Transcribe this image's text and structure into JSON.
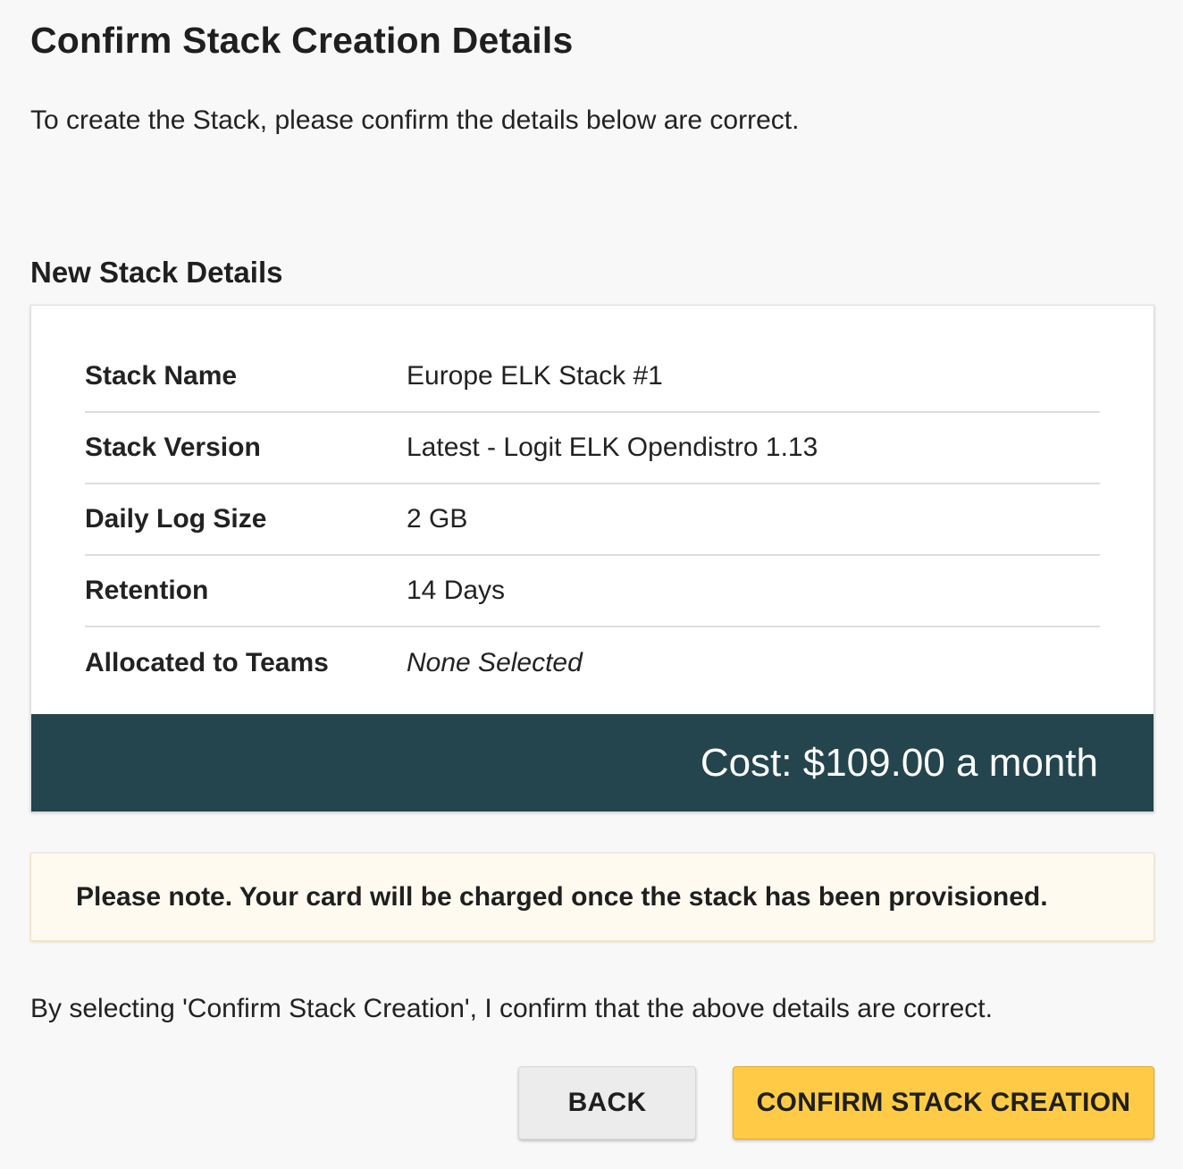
{
  "header": {
    "title": "Confirm Stack Creation Details",
    "intro": "To create the Stack, please confirm the details below are correct."
  },
  "details": {
    "section_title": "New Stack Details",
    "rows": [
      {
        "label": "Stack Name",
        "value": "Europe ELK Stack #1"
      },
      {
        "label": "Stack Version",
        "value": "Latest - Logit ELK Opendistro 1.13"
      },
      {
        "label": "Daily Log Size",
        "value": "2 GB"
      },
      {
        "label": "Retention",
        "value": "14 Days"
      },
      {
        "label": "Allocated to Teams",
        "value": "None Selected"
      }
    ],
    "cost": "Cost: $109.00 a month"
  },
  "notice": {
    "text": "Please note. Your card will be charged once the stack has been provisioned."
  },
  "consent": {
    "text": "By selecting 'Confirm Stack Creation', I confirm that the above details are correct."
  },
  "actions": {
    "back_label": "BACK",
    "confirm_label": "CONFIRM STACK CREATION"
  },
  "colors": {
    "background": "#f8f8f8",
    "cost_bar": "#24454d",
    "notice_bg": "#fffaf0",
    "confirm_button": "#ffcb47",
    "back_button": "#ececec"
  }
}
